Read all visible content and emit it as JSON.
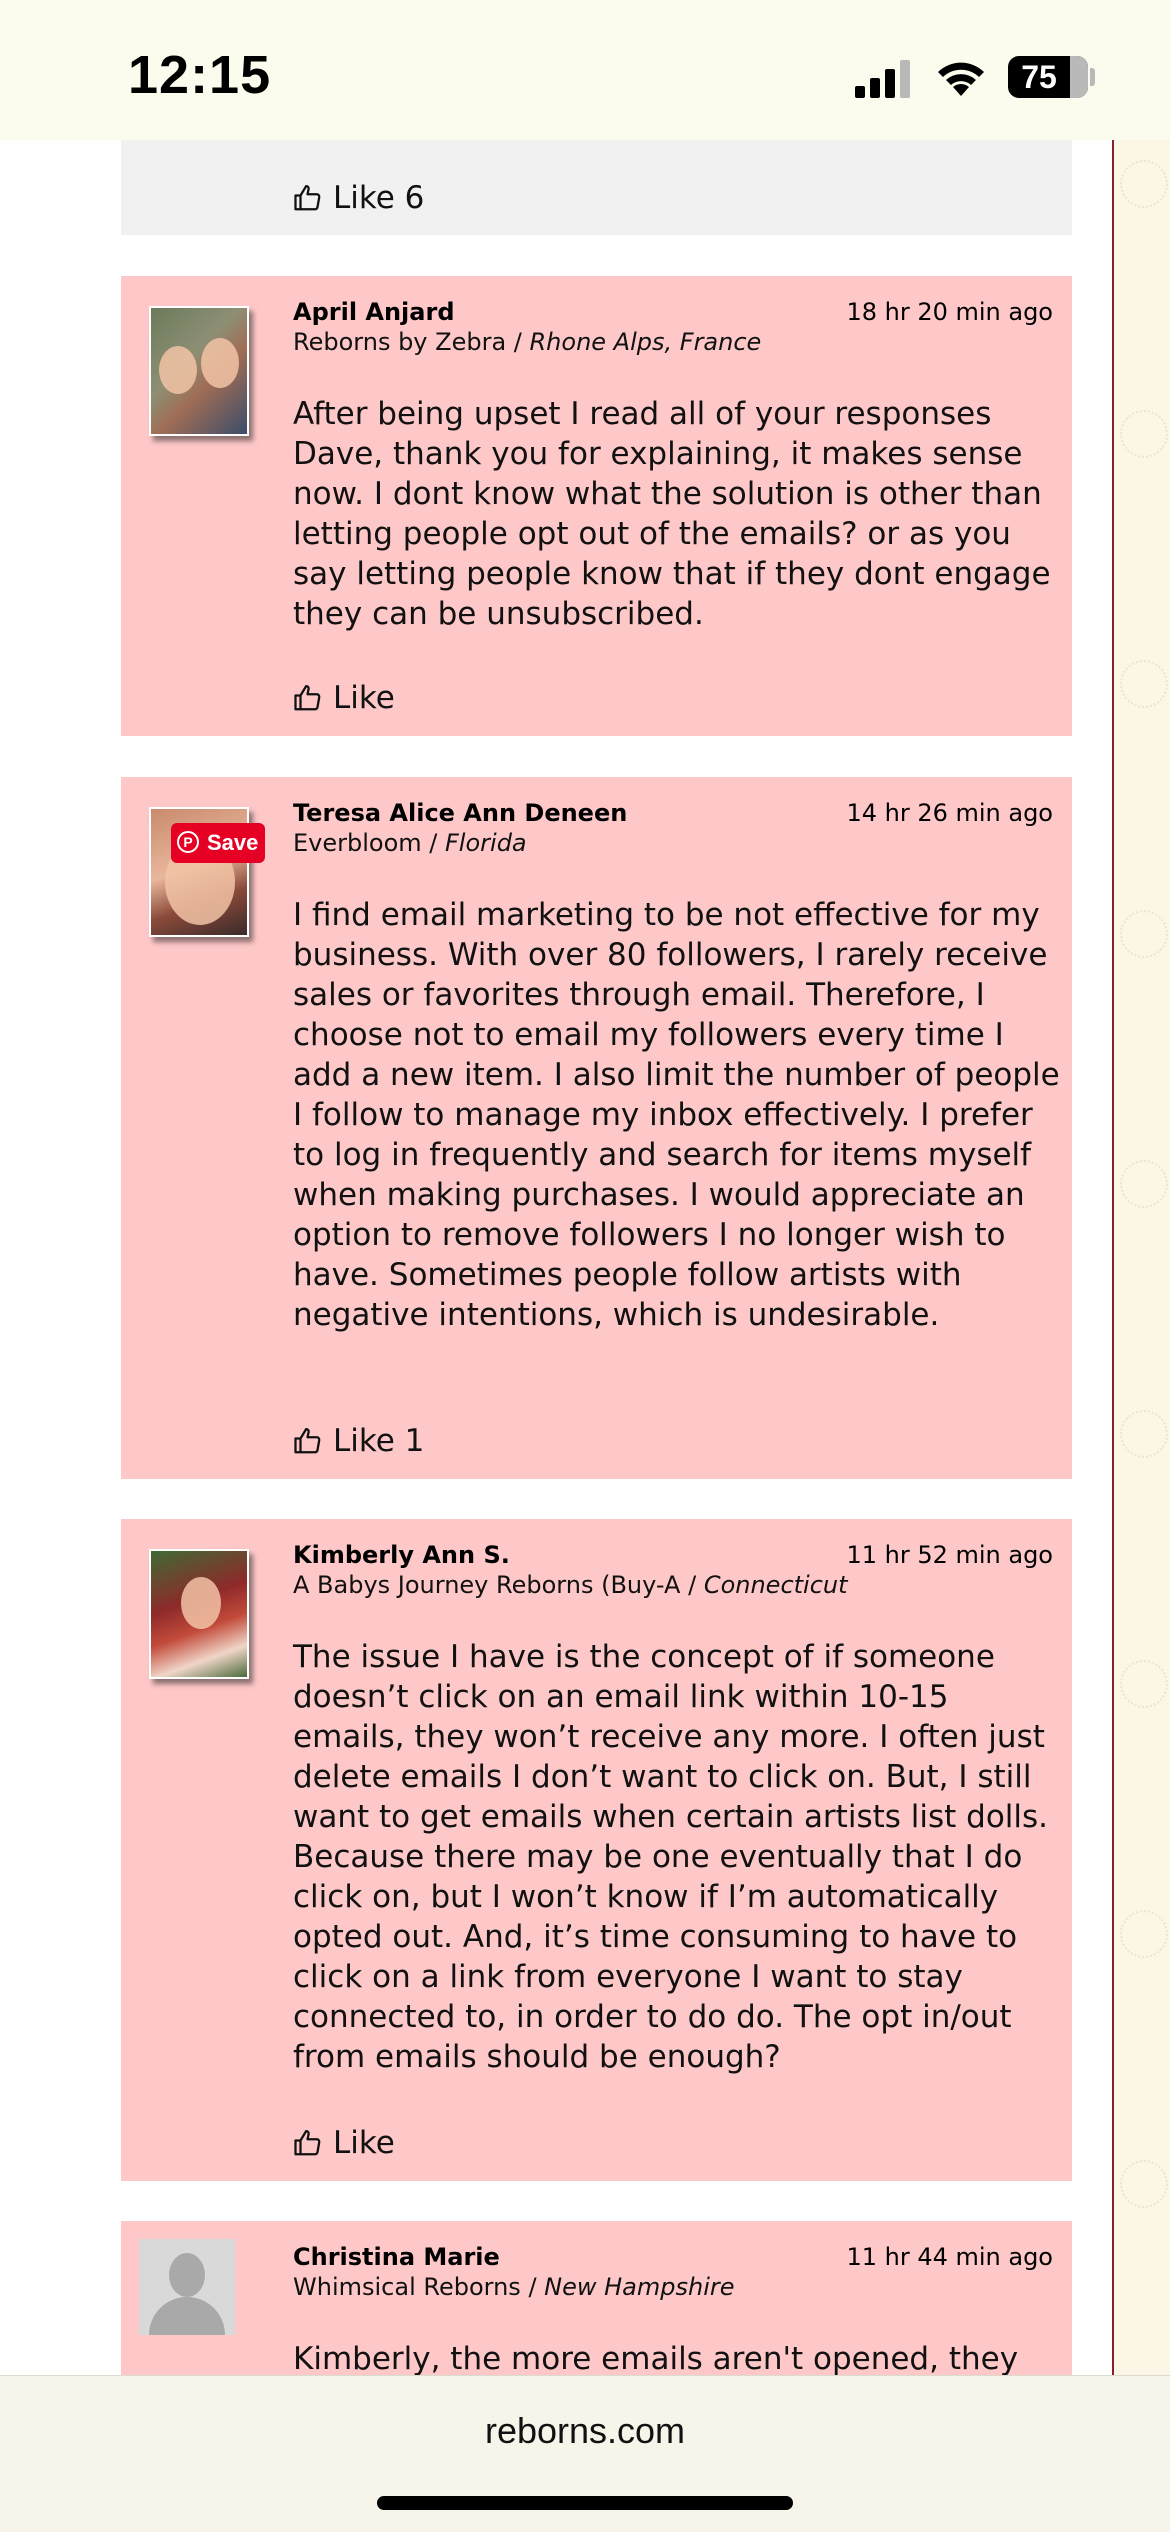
{
  "status_bar": {
    "time": "12:15",
    "battery_level": "75"
  },
  "comments": [
    {
      "like_label": "Like 6"
    },
    {
      "author": "April Anjard",
      "timestamp": "18 hr 20 min ago",
      "shop": "Reborns by Zebra",
      "location": "Rhone Alps, France",
      "body": "After being upset I read all of your responses Dave, thank you for explaining, it makes sense now. I dont know what the solution is other than letting people opt out of the emails? or as you say letting people know that if they dont engage they can be unsubscribed.",
      "like_label": "Like"
    },
    {
      "author": "Teresa Alice Ann Deneen",
      "timestamp": "14 hr 26 min ago",
      "shop": "Everbloom",
      "location": "Florida",
      "save_label": "Save",
      "body": "I find email marketing to be not effective for my business. With over 80 followers, I rarely receive sales or favorites through email. Therefore, I choose not to email my followers every time I add a new item. I also limit the number of people I follow to manage my inbox effectively. I prefer to log in frequently and search for items myself when making purchases. I would appreciate an option to remove followers I no longer wish to have. Sometimes people follow artists with negative intentions, which is undesirable.",
      "like_label": "Like 1"
    },
    {
      "author": "Kimberly Ann S.",
      "timestamp": "11 hr 52 min ago",
      "shop": "A Babys Journey Reborns (Buy-A",
      "location": "Connecticut",
      "body": "The issue I have is the concept of if someone doesn’t click on an email link within 10-15 emails, they won’t receive any more. I often just delete emails I don’t want to click on. But, I still want to get emails when certain artists list dolls. Because there may be one eventually that I do click on, but I won’t know if I’m automatically opted out. And, it’s time consuming to have to click on a link from everyone I want to stay connected to, in order to do do. The opt in/out from emails should be enough?",
      "like_label": "Like"
    },
    {
      "author": "Christina Marie",
      "timestamp": "11 hr 44 min ago",
      "shop": "Whimsical Reborns",
      "location": "New Hampshire",
      "body": "Kimberly, the more emails aren't opened, they"
    }
  ],
  "browser": {
    "url": "reborns.com"
  },
  "colors": {
    "comment_background": "#fec8c8",
    "previous_comment_background": "#f1f1f1",
    "save_badge": "#e60023",
    "status_bar_background": "#fcfcee"
  }
}
